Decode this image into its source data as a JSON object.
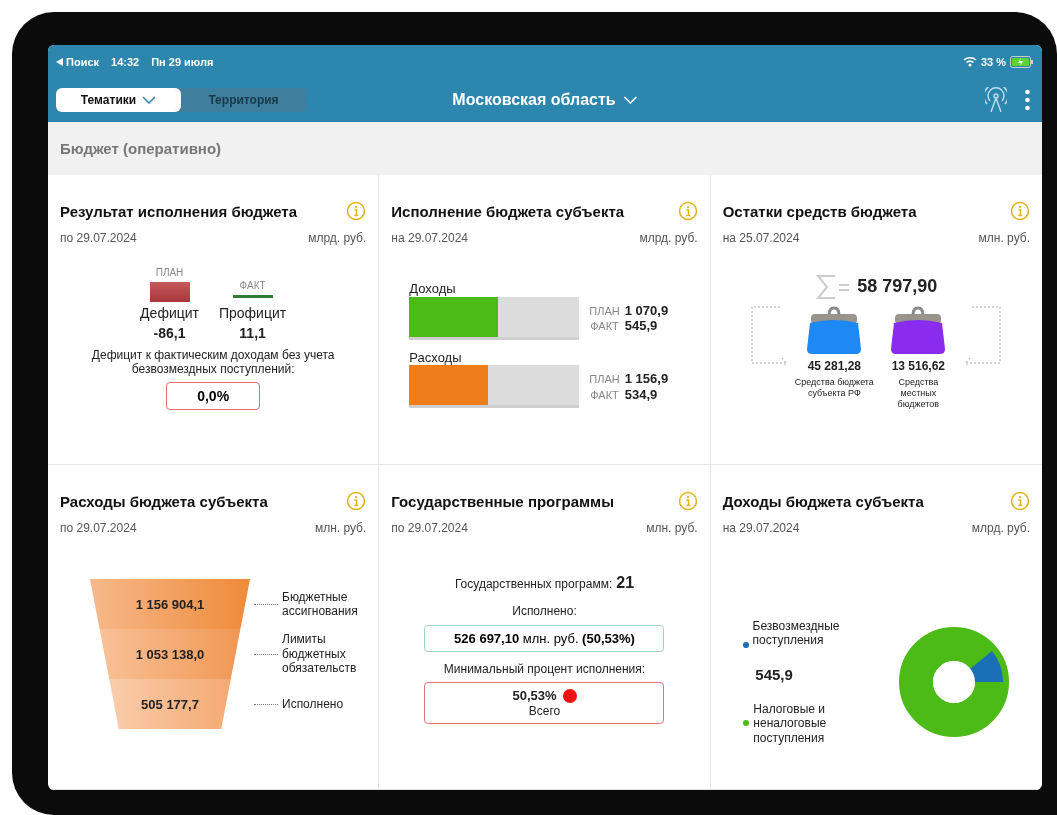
{
  "status_bar": {
    "back_label": "Поиск",
    "time": "14:32",
    "date": "Пн 29 июля",
    "battery": "33 %"
  },
  "nav": {
    "tabs": [
      {
        "label": "Тематики",
        "selected": true
      },
      {
        "label": "Территория",
        "selected": false
      }
    ],
    "region": "Московская область"
  },
  "section": {
    "title": "Бюджет (оперативно)"
  },
  "cards": [
    {
      "kind": "result",
      "title": "Результат исполнения бюджета",
      "date": "по 29.07.2024",
      "unit": "млрд. руб.",
      "plan_label": "ПЛАН",
      "fact_label": "ФАКТ",
      "deficit": {
        "label": "Дефицит",
        "value": "-86,1"
      },
      "surplus": {
        "label": "Профицит",
        "value": "11,1"
      },
      "note": "Дефицит к фактическим доходам без учета безвозмездных поступлений:",
      "percent": "0,0%"
    },
    {
      "kind": "execution",
      "title": "Исполнение бюджета субъекта",
      "date": "на 29.07.2024",
      "unit": "млрд. руб.",
      "bars": [
        {
          "label": "Доходы",
          "color": "#4cbb17",
          "level": 0.52,
          "plan_label": "ПЛАН",
          "plan": "1 070,9",
          "fact_label": "ФАКТ",
          "fact": "545,9"
        },
        {
          "label": "Расходы",
          "color": "#ee7d1a",
          "level": 0.46,
          "plan_label": "ПЛАН",
          "plan": "1 156,9",
          "fact_label": "ФАКТ",
          "fact": "534,9"
        }
      ]
    },
    {
      "kind": "balances",
      "title": "Остатки средств бюджета",
      "date": "на 25.07.2024",
      "unit": "млн. руб.",
      "total": "58 797,90",
      "purses": [
        {
          "value": "45 281,28",
          "label": "Средства бюджета субъекта РФ",
          "color": "#1e88f5"
        },
        {
          "value": "13 516,62",
          "label": "Средства местных бюджетов",
          "color": "#8a2cf0"
        }
      ]
    },
    {
      "kind": "expenses",
      "title": "Расходы бюджета субъекта",
      "date": "по 29.07.2024",
      "unit": "млн. руб.",
      "steps": [
        {
          "value": "1 156 904,1",
          "label": "Бюджетные ассигнования"
        },
        {
          "value": "1 053 138,0",
          "label": "Лимиты бюджетных обязательств"
        },
        {
          "value": "505 177,7",
          "label": "Исполнено"
        }
      ]
    },
    {
      "kind": "programs",
      "title": "Государственные программы",
      "date": "по 29.07.2024",
      "unit": "млн. руб.",
      "count_label": "Государственных программ:",
      "count": "21",
      "done_label": "Исполнено:",
      "done": "**526 697,10** млн. руб. **(50,53%)**",
      "min_label": "Минимальный процент исполнения:",
      "min_value": "50,53%",
      "min_caption": "Всего"
    },
    {
      "kind": "income",
      "title": "Доходы бюджета субъекта",
      "date": "на 29.07.2024",
      "unit": "млрд. руб.",
      "total": "545,9",
      "legend": [
        {
          "label": "Безвозмездные поступления",
          "color": "#1a6fb5"
        },
        {
          "label": "Налоговые и неналоговые поступления",
          "color": "#4cbb17"
        }
      ]
    }
  ]
}
